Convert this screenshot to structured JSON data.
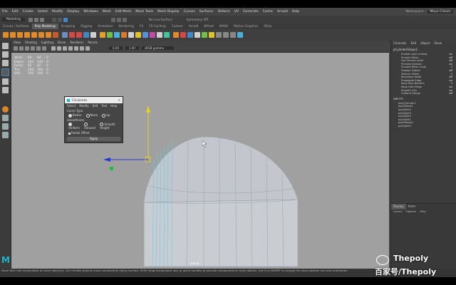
{
  "menubar": {
    "items": [
      "File",
      "Edit",
      "Create",
      "Select",
      "Modify",
      "Display",
      "Windows",
      "Mesh",
      "Edit Mesh",
      "Mesh Tools",
      "Mesh Display",
      "Curves",
      "Surfaces",
      "Deform",
      "UV",
      "Generate",
      "Cache",
      "Arnold",
      "Help"
    ],
    "workspace_label": "Workspace :",
    "workspace_value": "Maya Classic"
  },
  "statusline": {
    "mode_value": "Modeling",
    "no_live": "No Live Surface",
    "symmetry": "Symmetry: Off"
  },
  "shelf_tabs": [
    "Curves / Surfaces",
    "Poly Modeling",
    "Sculpting",
    "Rigging",
    "Animation",
    "Rendering",
    "FX",
    "FX Caching",
    "Custom",
    "Arnold",
    "Bifrost",
    "MASH",
    "Motion Graphics",
    "XGen"
  ],
  "shelf_active": "Poly Modeling",
  "panel_menu": [
    "View",
    "Shading",
    "Lighting",
    "Show",
    "Renderer",
    "Panels"
  ],
  "panel_field_a": "0.00",
  "panel_field_b": "1.00",
  "panel_colorspace": "sRGB gamma",
  "hud": {
    "rows": [
      {
        "label": "Verts:",
        "a": "64",
        "b": "64",
        "c": "0"
      },
      {
        "label": "Edges:",
        "a": "144",
        "b": "144",
        "c": "0"
      },
      {
        "label": "Faces:",
        "a": "82",
        "b": "82",
        "c": "0"
      },
      {
        "label": "Tris:",
        "a": "160",
        "b": "160",
        "c": "0"
      },
      {
        "label": "UVs:",
        "a": "100",
        "b": "100",
        "c": "0"
      }
    ]
  },
  "camera_label": "persp",
  "dialog": {
    "title": "Circularize",
    "menu": [
      "Select",
      "Modify",
      "Edit",
      "Tool",
      "Help"
    ],
    "curve_type_label": "Curve Type",
    "curve_options": [
      "Bezier",
      "None",
      "Up"
    ],
    "constraint_label": "Smoothness",
    "constraint_options": [
      "Uniform",
      "Relaxed",
      "Smooth Height"
    ],
    "check_label": "Radial Offset",
    "apply_label": "Apply"
  },
  "right_panel": {
    "tabs": [
      "Channels",
      "Edit",
      "Object",
      "Show"
    ],
    "object_name": "pCylinderShape1",
    "attributes": [
      {
        "name": "Enable Light Linking",
        "value": "on"
      },
      {
        "name": "Smooth Mesh",
        "value": "off"
      },
      {
        "name": "Use Shared Level",
        "value": "off"
      },
      {
        "name": "Preview Division",
        "value": "on"
      },
      {
        "name": "Smooth Mesh Level",
        "value": "1"
      },
      {
        "name": "Display Subdiv",
        "value": "off"
      },
      {
        "name": "Texture Offset",
        "value": "1"
      },
      {
        "name": "Boundary Mode",
        "value": "off"
      },
      {
        "name": "Propagate Edge",
        "value": "on"
      },
      {
        "name": "Keep Map Borders",
        "value": "1"
      },
      {
        "name": "Keep Hard Edge",
        "value": "on"
      },
      {
        "name": "Smooth UVs",
        "value": "on"
      },
      {
        "name": "Uniform Range",
        "value": "off"
      }
    ],
    "inputs_label": "INPUTS",
    "inputs_sub": "polyCylinder1",
    "input_items": [
      "polyTweak1",
      "polySplit4",
      "polySplit3",
      "polySplit2",
      "polySplit1",
      "polyTweak2",
      "polySplit5"
    ]
  },
  "layers": {
    "tabs": [
      "Display",
      "Anim"
    ],
    "sub": [
      "Layers",
      "Options",
      "Help"
    ]
  },
  "helpline": "Move Tool: Use manipulator to move object(s). Ctrl+middle-drag to move components along normals. Shift+drag manipulator axis or plane handles to extrude components or clone objects. Use D or INSERT to change the pivot position and axis orientation.",
  "logo": "M",
  "watermark": {
    "line1": "Thepoly",
    "line2": "百家号/Thepoly"
  },
  "colors": {
    "viewport_bg": "#a0a0a0",
    "mesh_fill": "#c9ccd1",
    "mesh_wire": "#9aa0a8",
    "mesh_selected": "#5fd0e6",
    "axis_y": "#e6d21a",
    "axis_x": "#2a3ad8",
    "axis_z": "#1bbf3a"
  }
}
